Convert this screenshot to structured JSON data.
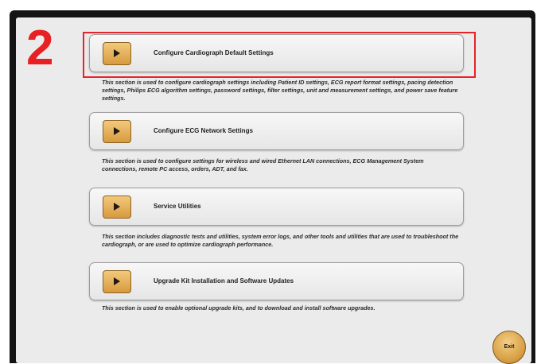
{
  "step_number": "2",
  "sections": [
    {
      "label": "Configure Cardiograph Default Settings",
      "description": "This section is used to configure cardiograph settings including Patient ID settings, ECG report format settings, pacing detection settings, Philips ECG algorithm settings, password settings, filter settings, unit and measurement settings, and power save feature settings.",
      "icon": "play-icon"
    },
    {
      "label": "Configure ECG Network Settings",
      "description": "This section is used to configure settings for wireless and wired Ethernet LAN connections, ECG Management System connections, remote PC access, orders, ADT, and fax.",
      "icon": "play-icon"
    },
    {
      "label": "Service Utilities",
      "description": "This section includes diagnostic tests and utilities, system error logs, and other tools and utilities that are used to troubleshoot the cardiograph, or are used to optimize cardiograph performance.",
      "icon": "play-icon"
    },
    {
      "label": "Upgrade Kit Installation and Software Updates",
      "description": "This section is used to enable optional upgrade kits, and to download and install software upgrades.",
      "icon": "play-icon"
    }
  ],
  "exit_label": "Exit",
  "colors": {
    "highlight": "#e5232a",
    "button_gold": "#d89a3e",
    "screen_bg": "#ecebeb"
  }
}
